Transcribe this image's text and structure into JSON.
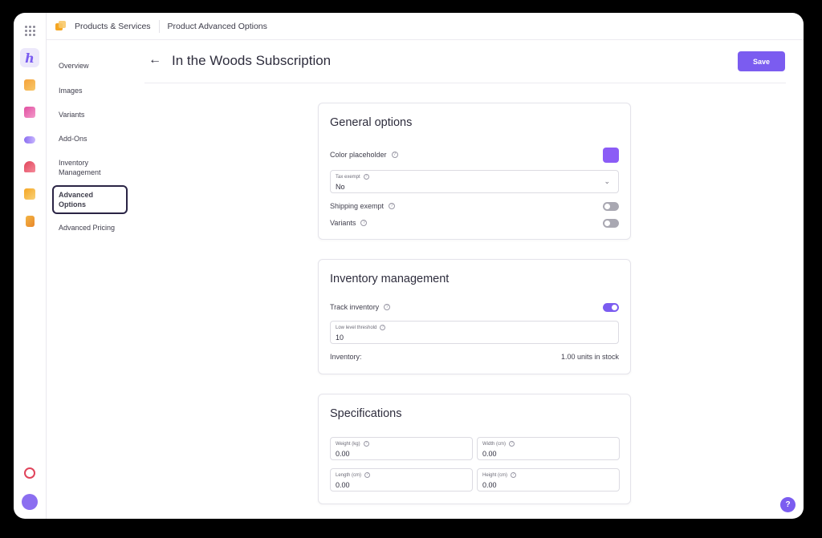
{
  "breadcrumb": {
    "section": "Products & Services",
    "page": "Product Advanced Options"
  },
  "rail": {
    "brand_letter": "h"
  },
  "subnav": {
    "items": [
      "Overview",
      "Images",
      "Variants",
      "Add-Ons",
      "Inventory Management",
      "Advanced Options",
      "Advanced Pricing"
    ],
    "active": "Advanced Options"
  },
  "header": {
    "back_icon": "arrow-left-icon",
    "title": "In the Woods Subscription",
    "save_label": "Save"
  },
  "general": {
    "title": "General options",
    "color_label": "Color placeholder",
    "color_value": "#8b5cf6",
    "tax_label": "Tax exempt",
    "tax_value": "No",
    "shipping_label": "Shipping exempt",
    "shipping_on": false,
    "variants_label": "Variants",
    "variants_on": false
  },
  "inventory": {
    "title": "Inventory management",
    "track_label": "Track inventory",
    "track_on": true,
    "threshold_label": "Low level threshold",
    "threshold_value": "10",
    "inventory_label": "Inventory:",
    "inventory_value": "1.00 units in stock"
  },
  "specs": {
    "title": "Specifications",
    "weight_label": "Weight (kg)",
    "weight_value": "0.00",
    "width_label": "Width (cm)",
    "width_value": "0.00",
    "length_label": "Length (cm)",
    "length_value": "0.00",
    "height_label": "Height (cm)",
    "height_value": "0.00"
  },
  "help_fab": "?",
  "colors": {
    "accent": "#7b5cf0"
  }
}
